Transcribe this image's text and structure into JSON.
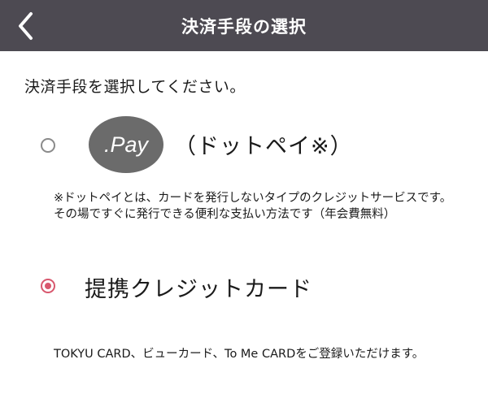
{
  "header": {
    "title": "決済手段の選択"
  },
  "instruction": "決済手段を選択してください。",
  "options": [
    {
      "logo_text": ".Pay",
      "label": "（ドットペイ※）",
      "note": "※ドットペイとは、カードを発行しないタイプのクレジットサービスです。その場ですぐに発行できる便利な支払い方法です（年会費無料）",
      "selected": false
    },
    {
      "label": "提携クレジットカード",
      "note": "TOKYU CARD、ビューカード、To Me CARDをご登録いただけます。",
      "selected": true
    }
  ],
  "colors": {
    "header_bg": "#4d4a52",
    "accent": "#d8586e",
    "logo_bg": "#6b6b6b"
  },
  "icons": {
    "back": "chevron-left-icon"
  }
}
